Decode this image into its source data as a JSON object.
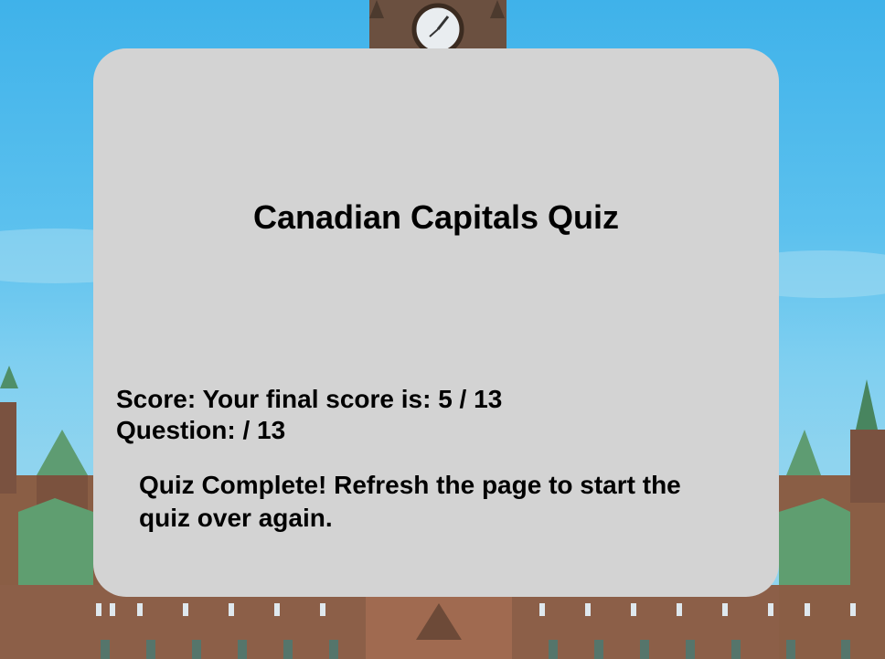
{
  "quiz": {
    "title": "Canadian Capitals Quiz",
    "score_label": "Score:",
    "score_value": "Your final score is: 5 / 13",
    "question_label": "Question:",
    "question_value": "/ 13",
    "message": "Quiz Complete! Refresh the page to start the quiz over again."
  },
  "colors": {
    "card_background": "#d3d3d3",
    "sky": "#5cc1ee",
    "text": "#000000"
  }
}
